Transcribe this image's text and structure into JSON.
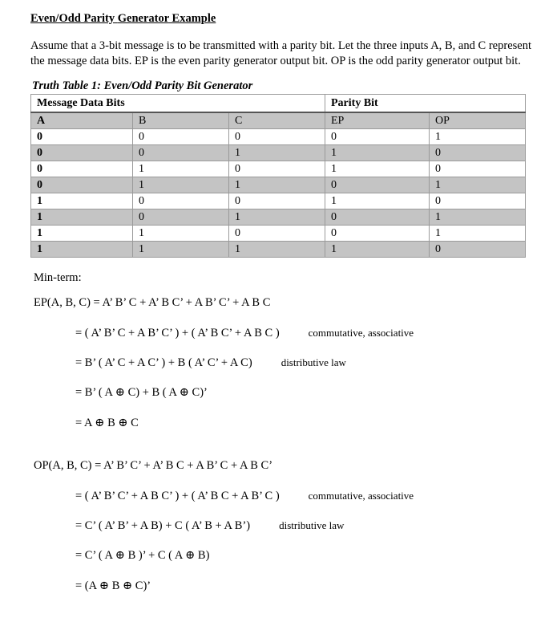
{
  "document": {
    "title": {
      "part1": "Even/Odd Parity ",
      "bold": "Generator",
      "part2": " Example"
    },
    "intro": "Assume that a 3-bit message is to be transmitted with a parity bit. Let the three inputs A, B, and C represent the message data bits. EP is the even parity generator output bit. OP is the odd parity generator output bit.",
    "table": {
      "caption": "Truth Table 1: Even/Odd Parity Bit Generator",
      "group_headers": [
        {
          "label": "Message Data Bits",
          "span": 3
        },
        {
          "label": "Parity Bit",
          "span": 2
        }
      ],
      "columns": [
        "A",
        "B",
        "C",
        "EP",
        "OP"
      ],
      "rows": [
        [
          "0",
          "0",
          "0",
          "0",
          "1"
        ],
        [
          "0",
          "0",
          "1",
          "1",
          "0"
        ],
        [
          "0",
          "1",
          "0",
          "1",
          "0"
        ],
        [
          "0",
          "1",
          "1",
          "0",
          "1"
        ],
        [
          "1",
          "0",
          "0",
          "1",
          "0"
        ],
        [
          "1",
          "0",
          "1",
          "0",
          "1"
        ],
        [
          "1",
          "1",
          "0",
          "0",
          "1"
        ],
        [
          "1",
          "1",
          "1",
          "1",
          "0"
        ]
      ]
    },
    "minterm_label": "Min-term:",
    "ep": {
      "line1": "EP(A, B, C) = A’ B’ C + A’ B C’ + A B’ C’ + A B C",
      "line2": "= ( A’ B’ C + A B’ C’ ) + ( A’ B C’ + A B C )",
      "line2_note": "commutative, associative",
      "line3": "= B’ ( A’ C + A C’ ) + B ( A’ C’ + A C)",
      "line3_note": "distributive law",
      "line4": "= B’ ( A ⊕ C) + B ( A ⊕ C)’",
      "line5": "= A ⊕ B ⊕ C"
    },
    "op": {
      "line1": "OP(A, B, C) = A’ B’ C’ + A’ B C + A B’ C + A B C’",
      "line2": "= ( A’ B’ C’ + A B C’ ) + ( A’ B C + A B’ C )",
      "line2_note": "commutative, associative",
      "line3": "= C’ ( A’ B’ + A B) + C ( A’ B + A B’)",
      "line3_note": "distributive law",
      "line4": "= C’ ( A ⊕ B )’  + C ( A ⊕  B)",
      "line5": "= (A ⊕ B ⊕ C)’"
    }
  }
}
